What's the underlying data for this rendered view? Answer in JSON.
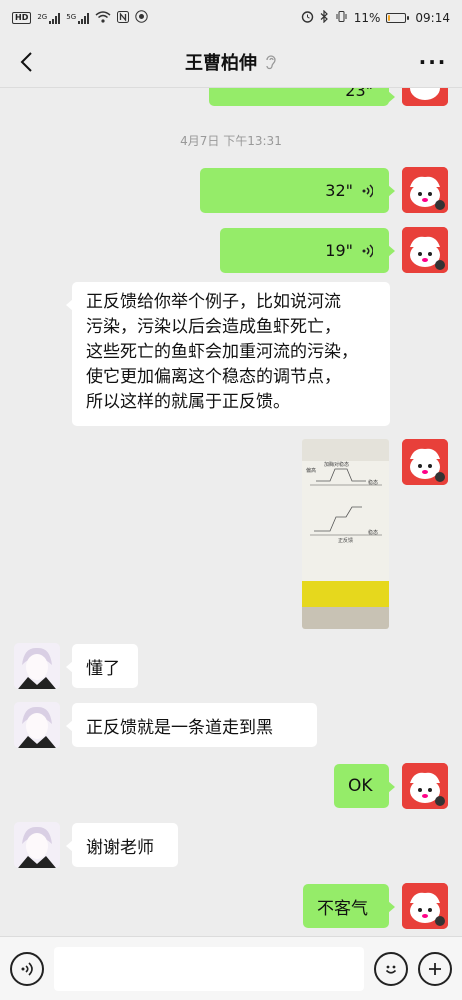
{
  "status_bar": {
    "left_chip": "HD",
    "network_1": "2G",
    "network_2": "5G",
    "battery_percent": "11%",
    "battery_level": 0.11,
    "time": "09:14"
  },
  "header": {
    "title": "王曹柏伸",
    "back_icon": "chevron-left-icon",
    "more_icon": "more-dots-icon",
    "more_label": "···"
  },
  "chat": {
    "partial_top_voice": "23\"",
    "timestamp": "4月7日 下午13:31",
    "voice_1": "32\"",
    "voice_2": "19\"",
    "long_text": [
      "正反馈给你举个例子，比如说河流",
      "污染，污染以后会造成鱼虾死亡，",
      "这些死亡的鱼虾会加重河流的污染，",
      "使它更加偏离这个稳态的调节点，",
      "所以这样的就属于正反馈。"
    ],
    "photo_labels": [
      "加酶对稳态",
      "稳态",
      "偏高",
      "正反馈",
      "稳态"
    ],
    "msg_1": "懂了",
    "msg_2": "正反馈就是一条道走到黑",
    "msg_3": "OK",
    "msg_4": "谢谢老师",
    "msg_5": "不客气"
  },
  "input_bar": {
    "voice_icon": "voice-input-icon",
    "emoji_icon": "emoji-icon",
    "plus_icon": "plus-icon"
  },
  "colors": {
    "my_bubble": "#95ec69",
    "other_bubble": "#ffffff",
    "background": "#ededed",
    "my_avatar": "#e8403a"
  }
}
